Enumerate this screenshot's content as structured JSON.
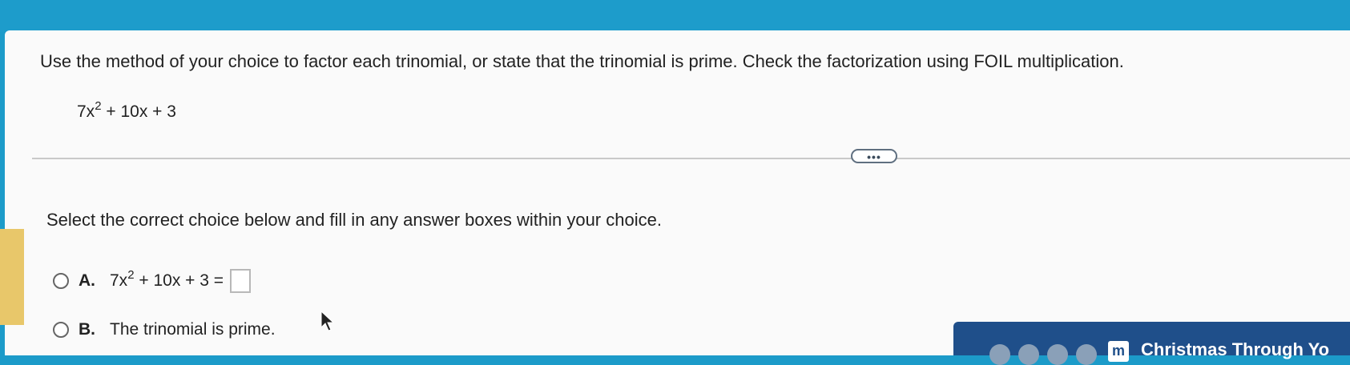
{
  "question": {
    "instruction": "Use the method of your choice to factor each trinomial, or state that the trinomial is prime. Check the factorization using FOIL multiplication.",
    "expression": {
      "coef": "7x",
      "exponent": "2",
      "rest": " + 10x + 3"
    }
  },
  "expand_button": {
    "label": "•••"
  },
  "prompt": "Select the correct choice below and fill in any answer boxes within your choice.",
  "choices": [
    {
      "letter": "A.",
      "expr_coef": "7x",
      "expr_exponent": "2",
      "expr_rest": " + 10x + 3 ="
    },
    {
      "letter": "B.",
      "text": "The trinomial is prime."
    }
  ],
  "taskbar": {
    "app_icon": "m",
    "title": "Christmas Through Yo"
  },
  "icons": [
    "radio-icon",
    "mouse-cursor-icon",
    "app-m-icon"
  ]
}
